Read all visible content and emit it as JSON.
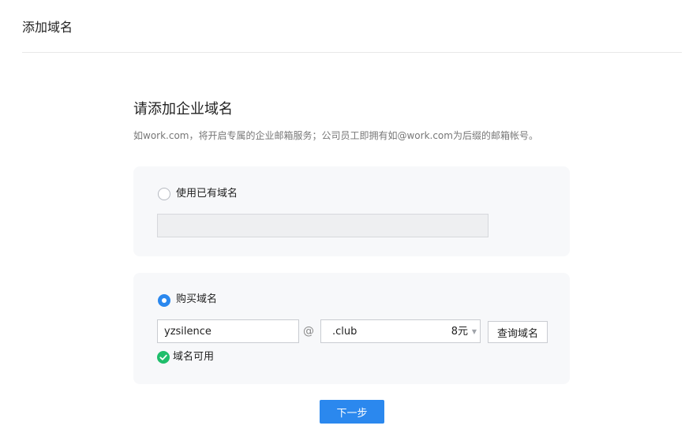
{
  "header": {
    "title": "添加域名"
  },
  "section": {
    "title": "请添加企业域名",
    "description": "如work.com，将开启专属的企业邮箱服务；公司员工即拥有如@work.com为后缀的邮箱帐号。"
  },
  "existing_option": {
    "label": "使用已有域名",
    "selected": false,
    "input_value": ""
  },
  "buy_option": {
    "label": "购买域名",
    "selected": true,
    "name_value": "yzsilence",
    "at_sign": "@",
    "suffix": ".club",
    "price": "8元",
    "query_label": "查询域名",
    "status_text": "域名可用",
    "status_color": "#1fbe6b"
  },
  "footer": {
    "next_label": "下一步"
  },
  "colors": {
    "primary": "#2b88ee",
    "card_bg": "#f7f8fa",
    "success": "#1fbe6b"
  }
}
